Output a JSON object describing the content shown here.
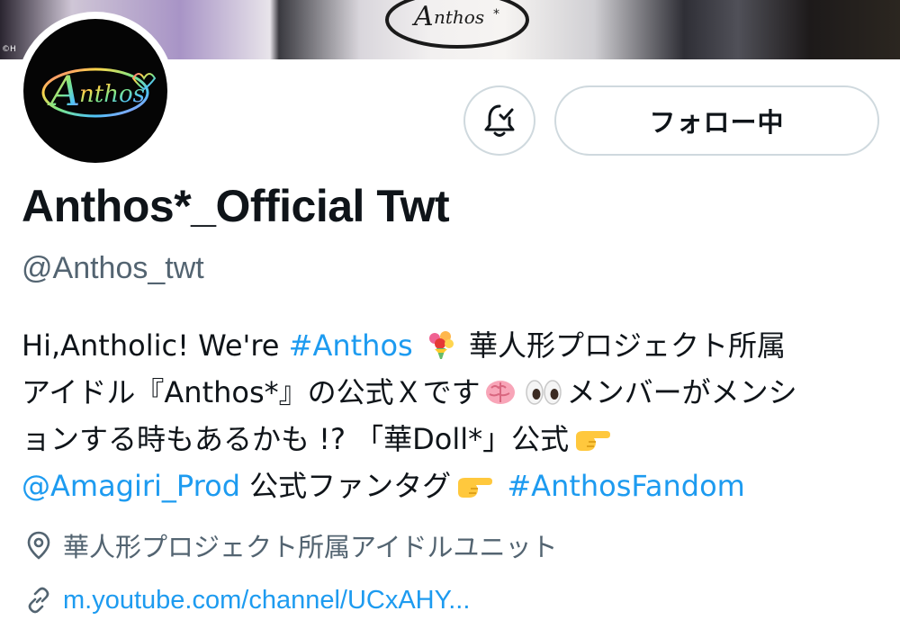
{
  "banner": {
    "copyright": "©H",
    "logo_text": "Anthos*"
  },
  "avatar": {
    "logo_text": "Anthos*"
  },
  "actions": {
    "notify_icon": "bell-check-icon",
    "follow_label": "フォロー中"
  },
  "profile": {
    "display_name": "Anthos*_Official Twt",
    "handle": "@Anthos_twt"
  },
  "bio": {
    "line1_a": "Hi,Antholic! We're ",
    "line1_hashtag": "#Anthos",
    "line1_emoji": "bouquet",
    "line1_b": " 華人形プロジェクト所属",
    "line2_a": "アイドル『Anthos*』の公式Ｘです",
    "line2_emoji1": "brain",
    "line2_emoji2": "eyes",
    "line2_b": "メンバーがメンシ",
    "line3_a": "ョンする時もあるかも !? 「華Doll*」公式",
    "line3_emoji": "backhand-index-pointing-right",
    "line4_mention": "@Amagiri_Prod",
    "line4_a": " 公式ファンタグ",
    "line4_emoji": "backhand-index-pointing-right",
    "line4_hashtag": "#AnthosFandom"
  },
  "meta": {
    "location_icon": "location-pin-icon",
    "location": "華人形プロジェクト所属アイドルユニット",
    "link_icon": "link-icon",
    "url": "m.youtube.com/channel/UCxAHY..."
  },
  "colors": {
    "link": "#1d9bf0",
    "secondary_text": "#536471",
    "border": "#cfd9de",
    "primary_text": "#0f1419"
  }
}
